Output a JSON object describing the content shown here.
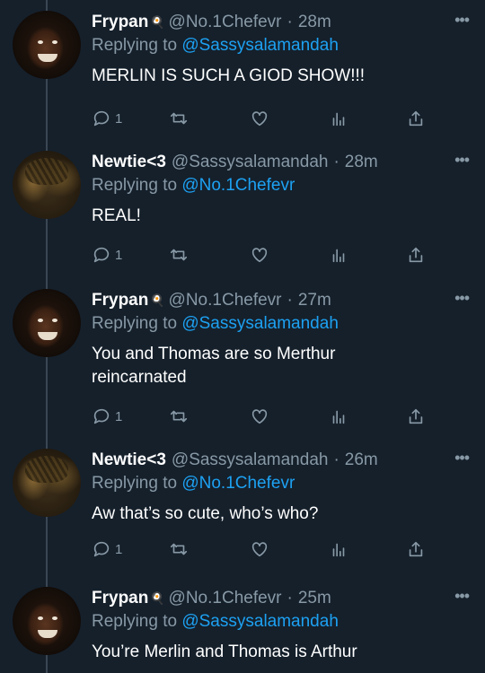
{
  "tweets": [
    {
      "avatar": "frypan-avatar",
      "name": "Frypan",
      "badge": "🍳",
      "handle": "@No.1Chefevr",
      "time": "28m",
      "replying_label": "Replying to",
      "replying_to": "@Sassysalamandah",
      "text": "MERLIN IS SUCH A GIOD SHOW!!!",
      "reply_count": "1",
      "more": "•••"
    },
    {
      "avatar": "newtie-avatar",
      "name": "Newtie<3",
      "badge": "",
      "handle": "@Sassysalamandah",
      "time": "28m",
      "replying_label": "Replying to",
      "replying_to": "@No.1Chefevr",
      "text": "REAL!",
      "reply_count": "1",
      "more": "•••"
    },
    {
      "avatar": "frypan-avatar",
      "name": "Frypan",
      "badge": "🍳",
      "handle": "@No.1Chefevr",
      "time": "27m",
      "replying_label": "Replying to",
      "replying_to": "@Sassysalamandah",
      "text": "You and Thomas are so Merthur reincarnated",
      "reply_count": "1",
      "more": "•••"
    },
    {
      "avatar": "newtie-avatar",
      "name": "Newtie<3",
      "badge": "",
      "handle": "@Sassysalamandah",
      "time": "26m",
      "replying_label": "Replying to",
      "replying_to": "@No.1Chefevr",
      "text": "Aw that’s so cute, who’s who?",
      "reply_count": "1",
      "more": "•••"
    },
    {
      "avatar": "frypan-avatar",
      "name": "Frypan",
      "badge": "🍳",
      "handle": "@No.1Chefevr",
      "time": "25m",
      "replying_label": "Replying to",
      "replying_to": "@Sassysalamandah",
      "text": "You’re Merlin and Thomas is Arthur",
      "reply_count": "",
      "more": "•••"
    }
  ],
  "colors": {
    "background": "#15202b",
    "muted": "#8899a6",
    "link": "#1da1f2",
    "text": "#ffffff"
  },
  "icons": [
    "reply-icon",
    "retweet-icon",
    "like-icon",
    "analytics-icon",
    "share-icon",
    "more-icon"
  ]
}
